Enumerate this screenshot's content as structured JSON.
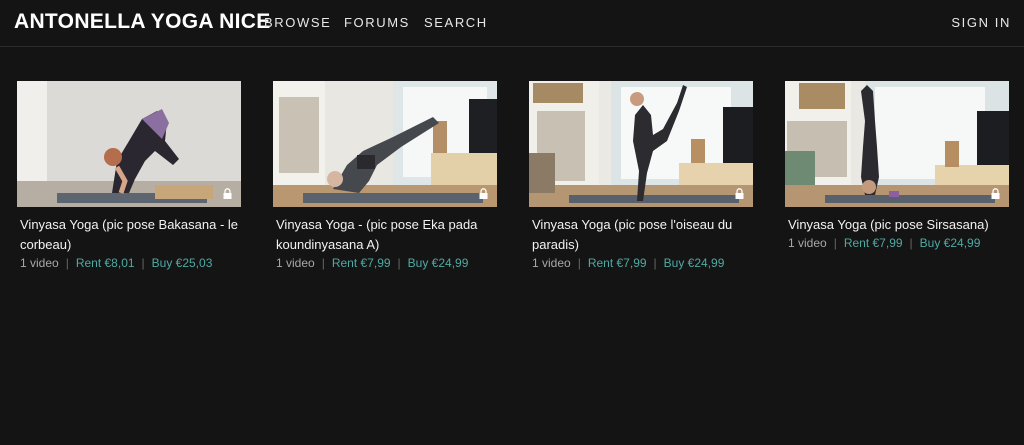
{
  "brand": "ANTONELLA YOGA NICE",
  "nav": {
    "browse": "BROWSE",
    "forums": "FORUMS",
    "search": "SEARCH",
    "sign_in": "SIGN IN"
  },
  "separator": "|",
  "videos": [
    {
      "title": "Vinyasa Yoga (pic pose Bakasana - le corbeau)",
      "count": "1 video",
      "rent": "Rent €8,01",
      "buy": "Buy €25,03",
      "lock_icon": "lock-icon"
    },
    {
      "title": "Vinyasa Yoga - (pic pose Eka pada koundinyasana A)",
      "count": "1 video",
      "rent": "Rent €7,99",
      "buy": "Buy €24,99",
      "lock_icon": "lock-icon"
    },
    {
      "title": "Vinyasa Yoga (pic pose l'oiseau du paradis)",
      "count": "1 video",
      "rent": "Rent €7,99",
      "buy": "Buy €24,99",
      "lock_icon": "lock-icon"
    },
    {
      "title": "Vinyasa Yoga (pic pose Sirsasana)",
      "count": "1 video",
      "rent": "Rent €7,99",
      "buy": "Buy €24,99",
      "lock_icon": "lock-icon"
    }
  ],
  "colors": {
    "background": "#141414",
    "price_accent": "#4fa9a3",
    "meta_text": "#a8a8a8"
  }
}
